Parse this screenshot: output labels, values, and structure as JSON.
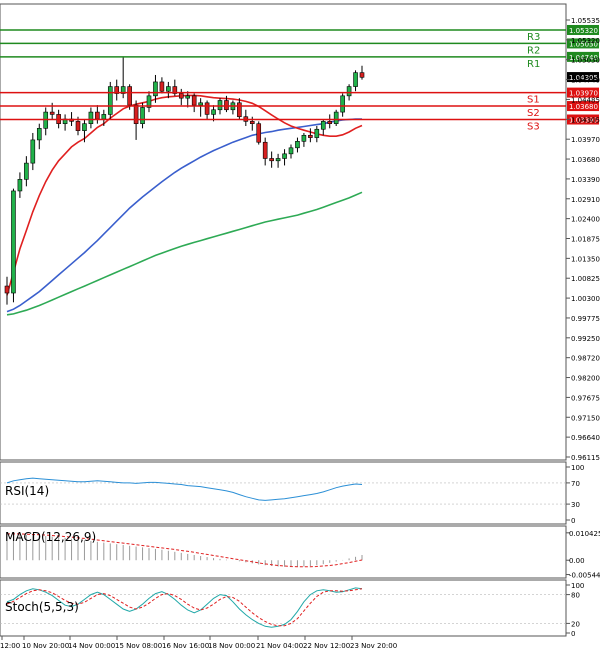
{
  "chart_data": {
    "type": "candlestick",
    "main": {
      "ylim": [
        0.96115,
        1.0555
      ],
      "y_ticks": [
        "1.05535",
        "1.05320",
        "1.05030",
        "1.04740",
        "1.04485",
        "1.04305",
        "1.03970",
        "1.03680",
        "1.03390",
        "1.02910",
        "1.02400",
        "1.01875",
        "1.01350",
        "1.00825",
        "1.00300",
        "0.99775",
        "0.99250",
        "0.98720",
        "0.98200",
        "0.97675",
        "0.97150",
        "0.96640",
        "0.96115"
      ],
      "current_price_label": "1.04305",
      "x_labels": [
        "12:00",
        "10 Nov 20:00",
        "14 Nov 00:00",
        "15 Nov 08:00",
        "16 Nov 16:00",
        "18 Nov 00:00",
        "21 Nov 04:00",
        "22 Nov 12:00",
        "23 Nov 20:00"
      ],
      "levels": [
        {
          "name": "R3",
          "value": 1.0532,
          "color": "#1f8a1f"
        },
        {
          "name": "R2",
          "value": 1.0503,
          "color": "#1f8a1f"
        },
        {
          "name": "R1",
          "value": 1.0474,
          "color": "#1f8a1f"
        },
        {
          "name": "S1",
          "value": 1.0397,
          "color": "#dd1111"
        },
        {
          "name": "S2",
          "value": 1.0368,
          "color": "#dd1111"
        },
        {
          "name": "S3",
          "value": 1.0339,
          "color": "#dd1111"
        }
      ],
      "level_labels": [
        "1.05320",
        "1.05030",
        "1.04740",
        "1.03970",
        "1.03680",
        "1.03390"
      ],
      "candles": [
        [
          0.998,
          1.0,
          0.994,
          0.9965
        ],
        [
          0.9965,
          1.019,
          0.9945,
          1.0185
        ],
        [
          1.0185,
          1.0225,
          1.017,
          1.021
        ],
        [
          1.021,
          1.026,
          1.0195,
          1.0245
        ],
        [
          1.0245,
          1.031,
          1.023,
          1.0295
        ],
        [
          1.0295,
          1.033,
          1.0275,
          1.032
        ],
        [
          1.032,
          1.0365,
          1.0305,
          1.0355
        ],
        [
          1.0355,
          1.0375,
          1.034,
          1.035
        ],
        [
          1.035,
          1.036,
          1.032,
          1.033
        ],
        [
          1.033,
          1.035,
          1.0315,
          1.034
        ],
        [
          1.034,
          1.0355,
          1.0325,
          1.0335
        ],
        [
          1.0335,
          1.0345,
          1.0305,
          1.0315
        ],
        [
          1.0315,
          1.034,
          1.029,
          1.033
        ],
        [
          1.033,
          1.0365,
          1.032,
          1.0355
        ],
        [
          1.0355,
          1.037,
          1.033,
          1.034
        ],
        [
          1.034,
          1.036,
          1.0325,
          1.035
        ],
        [
          1.035,
          1.042,
          1.034,
          1.041
        ],
        [
          1.041,
          1.0425,
          1.038,
          1.0395
        ],
        [
          1.0395,
          1.0475,
          1.0385,
          1.041
        ],
        [
          1.041,
          1.0415,
          1.036,
          1.037
        ],
        [
          1.037,
          1.038,
          1.0295,
          1.033
        ],
        [
          1.033,
          1.0375,
          1.032,
          1.0365
        ],
        [
          1.0365,
          1.04,
          1.0355,
          1.039
        ],
        [
          1.039,
          1.0435,
          1.0375,
          1.042
        ],
        [
          1.042,
          1.043,
          1.0395,
          1.04
        ],
        [
          1.04,
          1.042,
          1.0385,
          1.041
        ],
        [
          1.041,
          1.0425,
          1.039,
          1.0395
        ],
        [
          1.0395,
          1.0405,
          1.037,
          1.0385
        ],
        [
          1.0385,
          1.04,
          1.0365,
          1.039
        ],
        [
          1.039,
          1.0395,
          1.0355,
          1.037
        ],
        [
          1.037,
          1.0385,
          1.0345,
          1.0375
        ],
        [
          1.0375,
          1.038,
          1.034,
          1.035
        ],
        [
          1.035,
          1.037,
          1.0335,
          1.036
        ],
        [
          1.036,
          1.0385,
          1.035,
          1.038
        ],
        [
          1.038,
          1.039,
          1.0355,
          1.036
        ],
        [
          1.036,
          1.038,
          1.035,
          1.0375
        ],
        [
          1.0375,
          1.0385,
          1.034,
          1.0345
        ],
        [
          1.0345,
          1.036,
          1.0325,
          1.0335
        ],
        [
          1.0335,
          1.0345,
          1.0315,
          1.033
        ],
        [
          1.033,
          1.0335,
          1.0285,
          1.029
        ],
        [
          1.029,
          1.03,
          1.024,
          1.0255
        ],
        [
          1.0255,
          1.027,
          1.0235,
          1.025
        ],
        [
          1.025,
          1.0265,
          1.0235,
          1.0255
        ],
        [
          1.0255,
          1.0275,
          1.024,
          1.0265
        ],
        [
          1.0265,
          1.0285,
          1.0255,
          1.0278
        ],
        [
          1.0278,
          1.03,
          1.0268,
          1.0292
        ],
        [
          1.0292,
          1.031,
          1.028,
          1.0305
        ],
        [
          1.0305,
          1.032,
          1.029,
          1.03
        ],
        [
          1.03,
          1.0325,
          1.029,
          1.0318
        ],
        [
          1.0318,
          1.034,
          1.0305,
          1.0335
        ],
        [
          1.0335,
          1.035,
          1.032,
          1.033
        ],
        [
          1.033,
          1.036,
          1.0325,
          1.0355
        ],
        [
          1.0355,
          1.0395,
          1.0345,
          1.039
        ],
        [
          1.039,
          1.0415,
          1.038,
          1.041
        ],
        [
          1.041,
          1.0445,
          1.04,
          1.044
        ],
        [
          1.044,
          1.0455,
          1.0425,
          1.043
        ]
      ],
      "ma_fast": [
        0.996,
        1.001,
        1.006,
        1.01,
        1.014,
        1.0175,
        1.0205,
        1.023,
        1.025,
        1.0265,
        1.028,
        1.029,
        1.0298,
        1.031,
        1.0322,
        1.033,
        1.0342,
        1.0352,
        1.0362,
        1.0368,
        1.0372,
        1.0375,
        1.0378,
        1.0383,
        1.0386,
        1.0388,
        1.0389,
        1.039,
        1.0391,
        1.0391,
        1.039,
        1.0388,
        1.0386,
        1.0385,
        1.0384,
        1.0383,
        1.0381,
        1.0378,
        1.0374,
        1.0367,
        1.0358,
        1.0349,
        1.034,
        1.0332,
        1.0325,
        1.032,
        1.0316,
        1.0312,
        1.0308,
        1.0305,
        1.0303,
        1.0303,
        1.0306,
        1.0312,
        1.032,
        1.0326
      ],
      "ma_mid": [
        0.9925,
        0.993,
        0.9938,
        0.9948,
        0.9958,
        0.9968,
        0.998,
        0.9992,
        1.0004,
        1.0016,
        1.0028,
        1.004,
        1.0052,
        1.0065,
        1.0078,
        1.0092,
        1.0106,
        1.012,
        1.0134,
        1.0148,
        1.016,
        1.0172,
        1.0183,
        1.0194,
        1.0205,
        1.0215,
        1.0225,
        1.0234,
        1.0242,
        1.025,
        1.0258,
        1.0265,
        1.0272,
        1.0278,
        1.0284,
        1.029,
        1.0295,
        1.03,
        1.0305,
        1.0308,
        1.0311,
        1.0313,
        1.0316,
        1.0318,
        1.032,
        1.0322,
        1.0324,
        1.0326,
        1.0328,
        1.033,
        1.0333,
        1.0336,
        1.0338,
        1.0339,
        1.034,
        1.034
      ],
      "ma_slow": [
        0.9918,
        0.992,
        0.9924,
        0.9928,
        0.9933,
        0.9938,
        0.9944,
        0.995,
        0.9956,
        0.9962,
        0.9968,
        0.9974,
        0.998,
        0.9986,
        0.9992,
        0.9998,
        1.0004,
        1.001,
        1.0016,
        1.0022,
        1.0028,
        1.0034,
        1.004,
        1.0046,
        1.0051,
        1.0056,
        1.0061,
        1.0066,
        1.007,
        1.0074,
        1.0078,
        1.0082,
        1.0086,
        1.009,
        1.0094,
        1.0098,
        1.0102,
        1.0106,
        1.011,
        1.0114,
        1.0118,
        1.0121,
        1.0124,
        1.0127,
        1.013,
        1.0133,
        1.0137,
        1.0141,
        1.0145,
        1.015,
        1.0155,
        1.016,
        1.0165,
        1.017,
        1.0176,
        1.0182
      ]
    },
    "rsi": {
      "label": "RSI(14)",
      "ticks": [
        "100",
        "70",
        "30",
        "0"
      ],
      "values": [
        70,
        74,
        76,
        78,
        79,
        78,
        77,
        76,
        75,
        74,
        73,
        72,
        72,
        73,
        74,
        73,
        72,
        71,
        70,
        70,
        69,
        70,
        71,
        71,
        70,
        69,
        68,
        67,
        65,
        64,
        63,
        61,
        59,
        57,
        55,
        52,
        48,
        44,
        41,
        38,
        37,
        38,
        39,
        40,
        42,
        44,
        46,
        48,
        50,
        53,
        57,
        61,
        64,
        66,
        68,
        67
      ]
    },
    "macd": {
      "label": "MACD(12,26,9)",
      "ticks": [
        "0.010425",
        "0.00",
        "-0.005445"
      ],
      "ylim": [
        -0.006,
        0.0115
      ],
      "histogram": [
        0.0098,
        0.0099,
        0.0098,
        0.0097,
        0.0096,
        0.0094,
        0.0092,
        0.009,
        0.0088,
        0.0085,
        0.0082,
        0.0079,
        0.0076,
        0.0073,
        0.007,
        0.0067,
        0.0064,
        0.0061,
        0.0058,
        0.0055,
        0.0052,
        0.0049,
        0.0046,
        0.0043,
        0.004,
        0.0036,
        0.0032,
        0.0028,
        0.0024,
        0.002,
        0.0016,
        0.0012,
        0.0008,
        0.0005,
        0.0002,
        0.0,
        -0.0004,
        -0.0008,
        -0.0012,
        -0.0016,
        -0.0019,
        -0.0022,
        -0.0024,
        -0.0025,
        -0.0026,
        -0.0025,
        -0.0024,
        -0.0022,
        -0.0019,
        -0.0015,
        -0.001,
        -0.0005,
        0.0001,
        0.0007,
        0.0013,
        0.002
      ],
      "signal": [
        0.01,
        0.01,
        0.01,
        0.0099,
        0.0098,
        0.0097,
        0.0096,
        0.0094,
        0.0092,
        0.009,
        0.0088,
        0.0085,
        0.0083,
        0.008,
        0.0077,
        0.0074,
        0.0071,
        0.0068,
        0.0065,
        0.0062,
        0.0059,
        0.0056,
        0.0053,
        0.005,
        0.0047,
        0.0044,
        0.0041,
        0.0037,
        0.0034,
        0.003,
        0.0026,
        0.0022,
        0.0018,
        0.0014,
        0.001,
        0.0006,
        0.0002,
        -0.0002,
        -0.0006,
        -0.001,
        -0.0014,
        -0.0017,
        -0.002,
        -0.0022,
        -0.0024,
        -0.0025,
        -0.0025,
        -0.0025,
        -0.0024,
        -0.0022,
        -0.002,
        -0.0017,
        -0.0013,
        -0.0009,
        -0.0004,
        0.0001
      ]
    },
    "stoch": {
      "label": "Stoch(5,5,3)",
      "ticks": [
        "100",
        "80",
        "20",
        "0"
      ],
      "k": [
        65,
        70,
        80,
        88,
        92,
        90,
        85,
        78,
        68,
        58,
        55,
        60,
        70,
        80,
        85,
        80,
        70,
        60,
        50,
        45,
        50,
        60,
        72,
        82,
        86,
        80,
        70,
        58,
        48,
        42,
        48,
        60,
        72,
        80,
        78,
        65,
        50,
        38,
        28,
        20,
        14,
        12,
        14,
        18,
        28,
        45,
        65,
        80,
        88,
        90,
        88,
        85,
        86,
        90,
        94,
        92
      ],
      "d": [
        60,
        66,
        74,
        82,
        88,
        90,
        88,
        84,
        76,
        68,
        62,
        60,
        64,
        72,
        80,
        82,
        78,
        70,
        62,
        54,
        50,
        54,
        62,
        72,
        80,
        82,
        78,
        70,
        60,
        52,
        48,
        52,
        60,
        70,
        76,
        74,
        66,
        54,
        42,
        32,
        24,
        18,
        15,
        15,
        20,
        30,
        46,
        62,
        76,
        85,
        88,
        88,
        87,
        88,
        90,
        92
      ]
    }
  }
}
